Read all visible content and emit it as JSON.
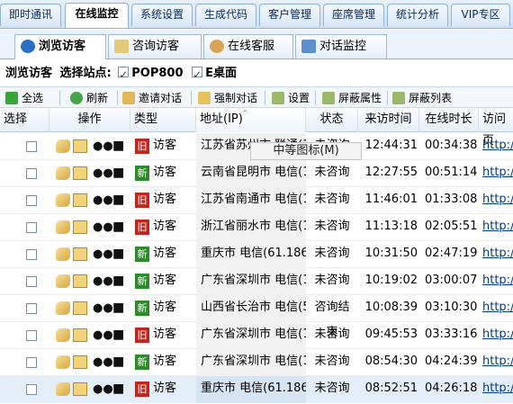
{
  "top_tabs": [
    {
      "label": "即时通讯"
    },
    {
      "label": "在线监控"
    },
    {
      "label": "系统设置"
    },
    {
      "label": "生成代码"
    },
    {
      "label": "客户管理"
    },
    {
      "label": "座席管理"
    },
    {
      "label": "统计分析"
    },
    {
      "label": "VIP专区"
    }
  ],
  "sub_tabs": [
    {
      "label": "浏览访客"
    },
    {
      "label": "咨询访客"
    },
    {
      "label": "在线客服"
    },
    {
      "label": "对话监控"
    }
  ],
  "site_filter": {
    "browse_label": "浏览访客",
    "select_label": "选择站点:",
    "sites": [
      {
        "label": "POP800",
        "checked": true
      },
      {
        "label": "E桌面",
        "checked": true
      }
    ]
  },
  "toolbar": {
    "select_all": "全选",
    "refresh": "刷新",
    "invite": "邀请对话",
    "force": "强制对话",
    "settings": "设置",
    "mask_attr": "屏蔽属性",
    "mask_list": "屏蔽列表"
  },
  "table": {
    "headers": [
      "选择",
      "操作",
      "类型",
      "地址(IP)",
      "状态",
      "来访时间",
      "在线时长",
      "访问页"
    ],
    "rows": [
      {
        "badge": "旧",
        "type": "访客",
        "address": "江苏省苏州市 联通(1",
        "status": "未咨询",
        "arrival": "12:44:31",
        "duration": "00:34:38",
        "url": "http:/"
      },
      {
        "badge": "新",
        "type": "访客",
        "address": "云南省昆明市 电信(1",
        "status": "未咨询",
        "arrival": "12:27:55",
        "duration": "00:51:14",
        "url": "http:/"
      },
      {
        "badge": "旧",
        "type": "访客",
        "address": "江苏省南通市 电信(1",
        "status": "未咨询",
        "arrival": "11:46:01",
        "duration": "01:33:08",
        "url": "http:/"
      },
      {
        "badge": "旧",
        "type": "访客",
        "address": "浙江省丽水市 电信(1",
        "status": "未咨询",
        "arrival": "11:13:18",
        "duration": "02:05:51",
        "url": "http:/"
      },
      {
        "badge": "新",
        "type": "访客",
        "address": "重庆市 电信(61.186",
        "status": "未咨询",
        "arrival": "10:31:50",
        "duration": "02:47:19",
        "url": "http:/"
      },
      {
        "badge": "新",
        "type": "访客",
        "address": "广东省深圳市 电信(1",
        "status": "未咨询",
        "arrival": "10:19:02",
        "duration": "03:00:07",
        "url": "http:/"
      },
      {
        "badge": "新",
        "type": "访客",
        "address": "山西省长治市 电信(5",
        "status": "咨询结束",
        "arrival": "10:08:39",
        "duration": "03:10:30",
        "url": "http:/"
      },
      {
        "badge": "旧",
        "type": "访客",
        "address": "广东省深圳市 电信(1",
        "status": "未咨询",
        "arrival": "09:45:53",
        "duration": "03:33:16",
        "url": "http:/"
      },
      {
        "badge": "新",
        "type": "访客",
        "address": "广东省深圳市 电信(1",
        "status": "未咨询",
        "arrival": "08:54:30",
        "duration": "04:24:39",
        "url": "http:/"
      },
      {
        "badge": "旧",
        "type": "访客",
        "address": "重庆市 电信(61.186",
        "status": "未咨询",
        "arrival": "08:52:51",
        "duration": "04:26:18",
        "url": "http:/"
      }
    ]
  },
  "tooltip": "中等图标(M)",
  "colors": {
    "old_badge": "#c0261e",
    "new_badge": "#2f8a2a",
    "link": "#003a8c"
  }
}
